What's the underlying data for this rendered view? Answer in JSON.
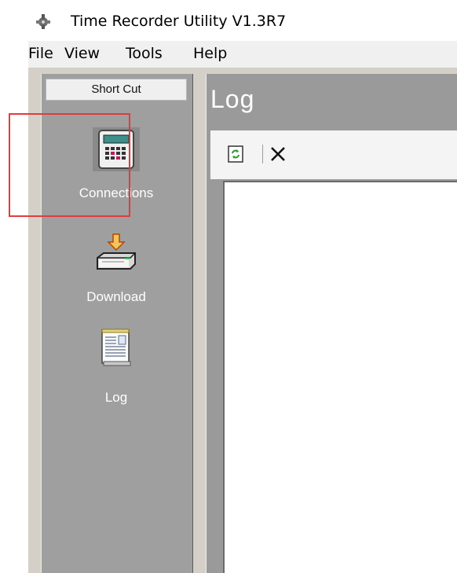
{
  "window": {
    "title": "Time Recorder Utility V1.3R7"
  },
  "menu": [
    "File",
    "View",
    "Tools",
    "Help"
  ],
  "sidebar": {
    "header": "Short Cut",
    "items": [
      {
        "label": "Connections",
        "icon": "time-clock-terminal-icon"
      },
      {
        "label": "Download",
        "icon": "download-device-icon"
      },
      {
        "label": "Log",
        "icon": "log-notepad-icon"
      }
    ]
  },
  "content": {
    "title": "Log",
    "toolbar": [
      {
        "icon": "refresh-icon"
      },
      {
        "icon": "delete-icon"
      }
    ]
  },
  "colors": {
    "panel_gray": "#9f9f9f",
    "highlight_box": "#e33b3b"
  }
}
